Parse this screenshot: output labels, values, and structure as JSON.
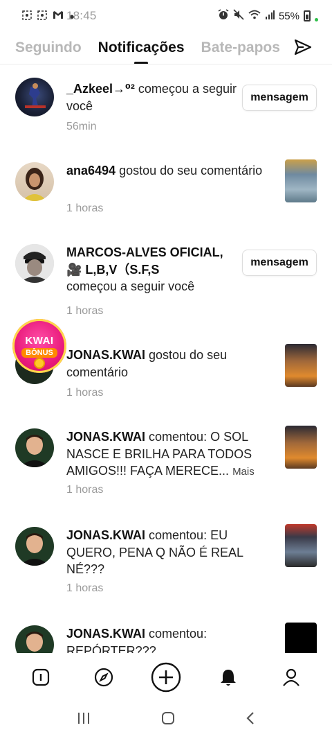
{
  "status_bar": {
    "time": "18:45",
    "battery": "55%",
    "icons": [
      "screenshot-icon",
      "screenshot-icon",
      "gmail-icon",
      "dot-icon",
      "alarm-icon",
      "mute-icon",
      "wifi-icon",
      "signal-icon",
      "battery-icon"
    ]
  },
  "tabs": [
    {
      "label": "Seguindo"
    },
    {
      "label": "Notificações"
    },
    {
      "label": "Bate-papos"
    }
  ],
  "notifications": [
    {
      "user": "_Azkeel→⁰²",
      "text": " começou a seguir você",
      "time": "56min",
      "action": "mensagem"
    },
    {
      "user": "ana6494",
      "text": " gostou do seu comentário",
      "time": "1 horas"
    },
    {
      "user": "MARCOS-ALVES OFICIAL,🎥 L,B,V（S.F,S",
      "text": "começou a seguir você",
      "time": "1 horas",
      "action": "mensagem"
    },
    {
      "user": "JONAS.KWAI",
      "text": " gostou do seu comentário",
      "time": "1 horas"
    },
    {
      "user": "JONAS.KWAI",
      "text": " comentou: O SOL NASCE E BRILHA PARA TODOS AMIGOS!!! FAÇA MERECE...",
      "more": "Mais",
      "time": "1 horas"
    },
    {
      "user": "JONAS.KWAI",
      "text": " comentou: EU QUERO, PENA Q NÃO É REAL NÉ???",
      "time": "1 horas"
    },
    {
      "user": "JONAS.KWAI",
      "text": " comentou: REPÓRTER???",
      "time": ""
    }
  ],
  "kwai_badge": {
    "title": "KWAI",
    "subtitle": "BÔNUS"
  },
  "bottom_nav": [
    "home-icon",
    "discover-icon",
    "add-icon",
    "notifications-icon",
    "profile-icon"
  ],
  "colors": {
    "accent": "#111111",
    "muted": "#9a9a9a",
    "tab_inactive": "#b8b8b8"
  }
}
